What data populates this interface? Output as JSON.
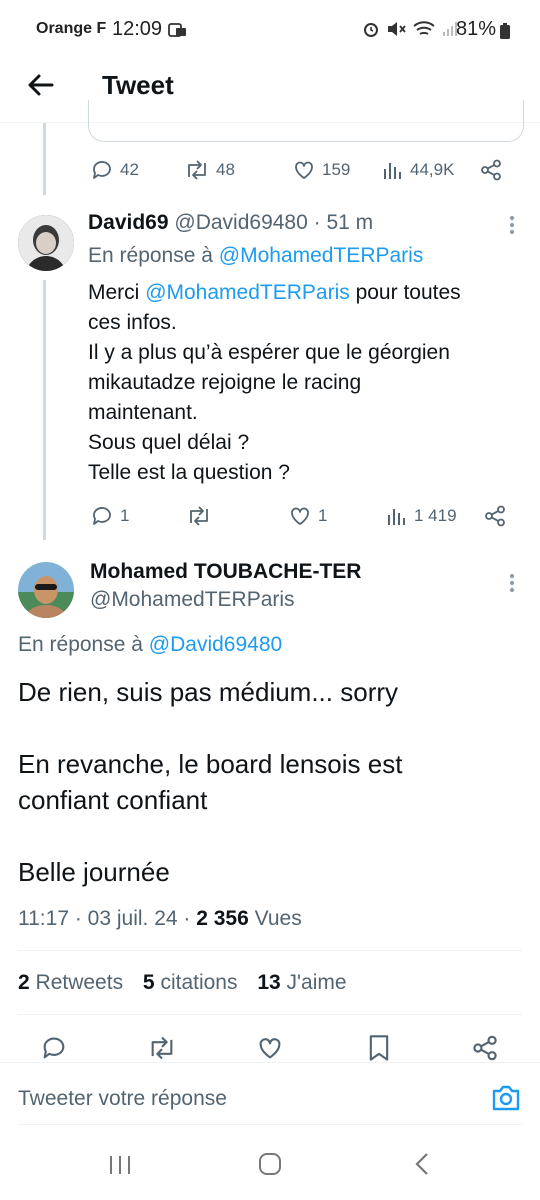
{
  "status_bar": {
    "carrier": "Orange F",
    "time": "12:09",
    "battery": "81%"
  },
  "header": {
    "title": "Tweet"
  },
  "prev_tweet_actions": {
    "replies": "42",
    "retweets": "48",
    "likes": "159",
    "views": "44,9K"
  },
  "reply_tweet": {
    "name": "David69",
    "handle": "@David69480",
    "time": "· 51 m",
    "in_reply_prefix": "En réponse à",
    "in_reply_handle": "@MohamedTERParis",
    "text_line1_prefix": "Merci",
    "text_line1_mention": "@MohamedTERParis",
    "text_line1_suffix": "pour toutes",
    "text_line2": "ces infos.",
    "text_line3": "Il y a plus qu’à espérer que le géorgien",
    "text_line4": "mikautadze rejoigne le racing",
    "text_line5": "maintenant.",
    "text_line6": "Sous quel délai ?",
    "text_line7": "Telle est la question ?",
    "replies": "1",
    "retweets": "",
    "likes": "1",
    "views": "1 419"
  },
  "main_tweet": {
    "name": "Mohamed TOUBACHE-TER",
    "handle": "@MohamedTERParis",
    "in_reply_prefix": "En réponse à",
    "in_reply_handle": "@David69480",
    "text_p1": "De rien, suis pas médium... sorry",
    "text_p2_line1": "En revanche, le board lensois est",
    "text_p2_line2": "confiant confiant",
    "text_p3": "Belle journée",
    "timestamp": "11:17 · 03 juil. 24 ·",
    "views_count": "2 356",
    "views_label": "Vues",
    "retweets_count": "2",
    "retweets_label": "Retweets",
    "quotes_count": "5",
    "quotes_label": "citations",
    "likes_count": "13",
    "likes_label": "J'aime"
  },
  "compose": {
    "placeholder": "Tweeter votre réponse"
  },
  "colors": {
    "accent": "#1d9bf0",
    "text": "#0f1419",
    "secondary": "#536471",
    "divider": "#eff3f4"
  }
}
